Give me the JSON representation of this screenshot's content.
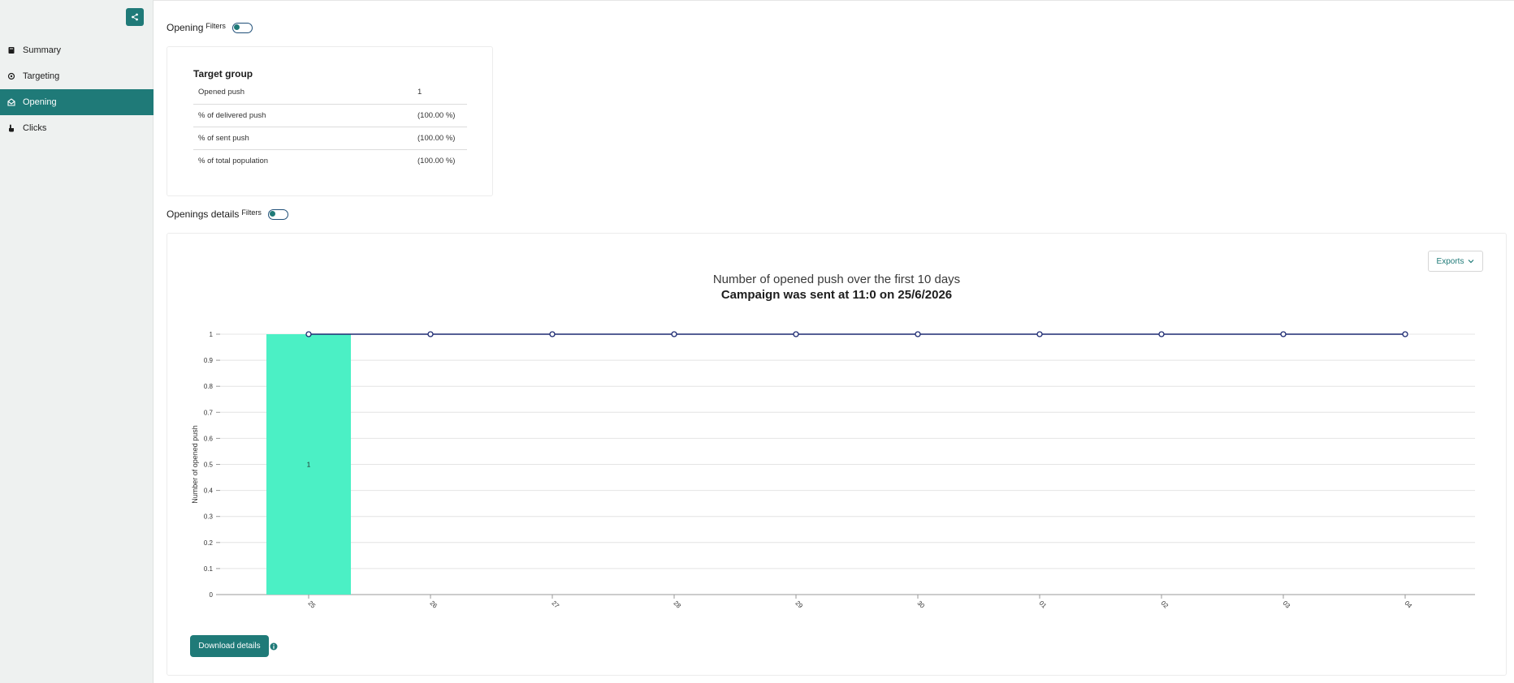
{
  "sidebar": {
    "items": [
      {
        "label": "Summary",
        "icon": "book-icon"
      },
      {
        "label": "Targeting",
        "icon": "target-icon"
      },
      {
        "label": "Opening",
        "icon": "envelope-open-icon",
        "active": true
      },
      {
        "label": "Clicks",
        "icon": "pointer-hand-icon"
      }
    ]
  },
  "opening_section": {
    "title": "Opening",
    "filters_label": "Filters",
    "target_group": {
      "title": "Target group",
      "rows": [
        {
          "label": "Opened push",
          "value": "1"
        },
        {
          "label": "% of delivered push",
          "value": "(100.00 %)"
        },
        {
          "label": "% of sent push",
          "value": "(100.00 %)"
        },
        {
          "label": "% of total population",
          "value": "(100.00 %)"
        }
      ]
    }
  },
  "details_section": {
    "title": "Openings details",
    "filters_label": "Filters",
    "exports_label": "Exports",
    "download_label": "Download details"
  },
  "chart_data": {
    "type": "bar",
    "title": "Number of opened push over the first 10 days",
    "subtitle": "Campaign was sent at 11:0 on 25/6/2026",
    "ylabel": "Number of opened push",
    "xlabel": "",
    "categories": [
      "25",
      "26",
      "27",
      "28",
      "29",
      "30",
      "01",
      "02",
      "03",
      "04"
    ],
    "ylim": [
      0,
      1
    ],
    "yticks": [
      "0",
      "0.1",
      "0.2",
      "0.3",
      "0.4",
      "0.5",
      "0.6",
      "0.7",
      "0.8",
      "0.9",
      "1"
    ],
    "grid": true,
    "series": [
      {
        "type": "bar",
        "values": [
          1,
          0,
          0,
          0,
          0,
          0,
          0,
          0,
          0,
          0
        ],
        "color": "#4bf0c5",
        "data_labels": [
          "1"
        ]
      },
      {
        "type": "line",
        "values": [
          1,
          1,
          1,
          1,
          1,
          1,
          1,
          1,
          1,
          1
        ],
        "color": "#1d2a72"
      }
    ]
  },
  "colors": {
    "accent": "#1f7a78",
    "bar": "#4bf0c5",
    "line": "#1d2a72"
  }
}
